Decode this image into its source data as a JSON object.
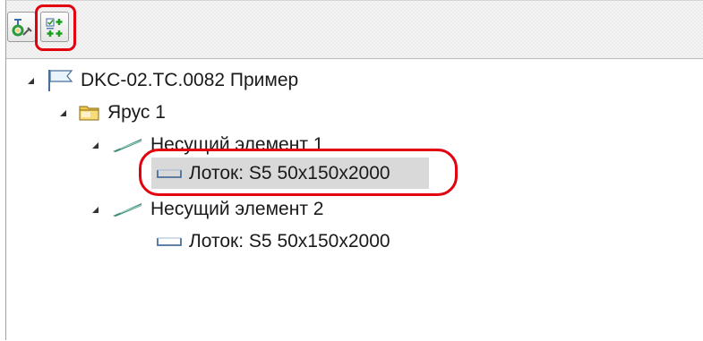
{
  "toolbar": {
    "buttons": [
      {
        "name": "structure-tool",
        "icon": "stand-wrench-icon"
      },
      {
        "name": "add-elements",
        "icon": "checkbox-add-icon"
      }
    ],
    "highlight_color": "#e3000f"
  },
  "tree": {
    "root": {
      "label": "DKC-02.TC.0082 Пример",
      "icon": "flag-icon",
      "expanded": true
    },
    "tier": {
      "label": "Ярус 1",
      "icon": "folder-icon",
      "expanded": true
    },
    "bearers": [
      {
        "label": "Несущий элемент 1",
        "icon": "pennant-icon",
        "expanded": true,
        "child": {
          "label": "Лоток: S5 50x150x2000",
          "icon": "tray-icon",
          "selected": true
        }
      },
      {
        "label": "Несущий элемент 2",
        "icon": "pennant-icon",
        "expanded": true,
        "child": {
          "label": "Лоток: S5 50x150x2000",
          "icon": "tray-icon",
          "selected": false
        }
      }
    ]
  },
  "colors": {
    "selection": "#d9d9d9",
    "annotation": "#e3000f"
  }
}
